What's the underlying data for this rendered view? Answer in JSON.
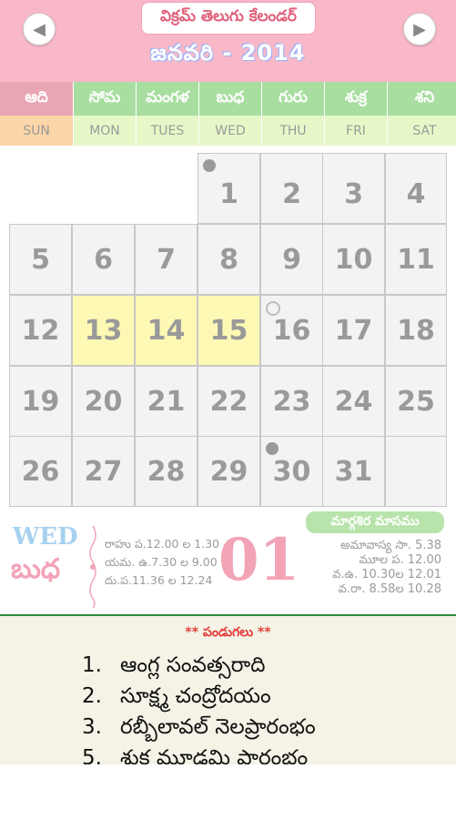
{
  "header": {
    "app_title": "విక్రమ్ తెలుగు కేలండర్",
    "month_title": "జనవరి - 2014",
    "prev_icon": "arrow-left-icon",
    "next_icon": "arrow-right-icon",
    "prev_glyph": "◀",
    "next_glyph": "▶",
    "bg_color": "#f8b8c8"
  },
  "weekdays": [
    {
      "te": "ఆది",
      "en": "SUN",
      "te_color": "#e8a6b2",
      "en_color": "#fbd6a8"
    },
    {
      "te": "సోమ",
      "en": "MON",
      "te_color": "#a8dea0",
      "en_color": "#e6f8c8"
    },
    {
      "te": "మంగళ",
      "en": "TUES",
      "te_color": "#a8dea0",
      "en_color": "#e6f8c8"
    },
    {
      "te": "బుధ",
      "en": "WED",
      "te_color": "#a8dea0",
      "en_color": "#e6f8c8"
    },
    {
      "te": "గురు",
      "en": "THU",
      "te_color": "#a8dea0",
      "en_color": "#e6f8c8"
    },
    {
      "te": "శుక్ర",
      "en": "FRI",
      "te_color": "#a8dea0",
      "en_color": "#e6f8c8"
    },
    {
      "te": "శని",
      "en": "SAT",
      "te_color": "#a8dea0",
      "en_color": "#e6f8c8"
    }
  ],
  "days": [
    {
      "n": "1",
      "highlight": false,
      "moon": "full"
    },
    {
      "n": "2"
    },
    {
      "n": "3"
    },
    {
      "n": "4"
    },
    {
      "n": "5"
    },
    {
      "n": "6"
    },
    {
      "n": "7"
    },
    {
      "n": "8"
    },
    {
      "n": "9"
    },
    {
      "n": "10"
    },
    {
      "n": "11"
    },
    {
      "n": "12"
    },
    {
      "n": "13",
      "highlight": true
    },
    {
      "n": "14",
      "highlight": true
    },
    {
      "n": "15",
      "highlight": true
    },
    {
      "n": "16",
      "moon": "hollow"
    },
    {
      "n": "17"
    },
    {
      "n": "18"
    },
    {
      "n": "19"
    },
    {
      "n": "20"
    },
    {
      "n": "21"
    },
    {
      "n": "22"
    },
    {
      "n": "23"
    },
    {
      "n": "24"
    },
    {
      "n": "25"
    },
    {
      "n": "26"
    },
    {
      "n": "27"
    },
    {
      "n": "28"
    },
    {
      "n": "29"
    },
    {
      "n": "30",
      "moon": "full"
    },
    {
      "n": "31"
    }
  ],
  "first_weekday_index": 3,
  "day_detail": {
    "weekday_en": "WED",
    "weekday_te": "బుధ",
    "date": "01",
    "masam": "మార్గశిర మాసము",
    "timings": [
      "రాహు ప.12.00 ల 1.30",
      "యమ. ఉ.7.30 ల 9.00",
      "దు.ప.11.36 ల 12.24"
    ],
    "panchang": [
      "అమావాస్య సా. 5.38",
      "మూల ప. 12.00",
      "వ.ఉ. 10.30ల 12.01",
      "వ.రా. 8.58ల 10.28"
    ]
  },
  "festivals": {
    "heading": "** పండుగలు **",
    "items": [
      {
        "num": "1.",
        "text": "ఆంగ్ల సంవత్సరాది"
      },
      {
        "num": "2.",
        "text": "సూక్ష్మ చంద్రోదయం"
      },
      {
        "num": "3.",
        "text": "రబ్బీలావల్ నెలప్రారంభం"
      },
      {
        "num": "5.",
        "text": "శుక్ర మూఢమి ప్రారంభం"
      }
    ]
  }
}
